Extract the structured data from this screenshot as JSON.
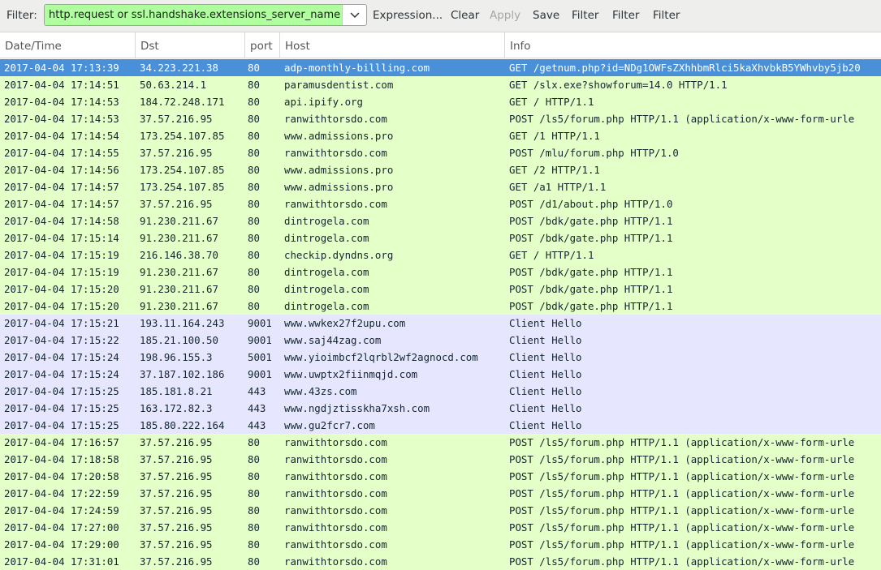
{
  "toolbar": {
    "filter_label": "Filter:",
    "filter_value": "http.request or ssl.handshake.extensions_server_name",
    "expression_label": "Expression...",
    "clear_label": "Clear",
    "apply_label": "Apply",
    "save_label": "Save",
    "filter_buttons": [
      "Filter",
      "Filter",
      "Filter"
    ]
  },
  "columns": [
    "Date/Time",
    "Dst",
    "port",
    "Host",
    "Info"
  ],
  "colors": {
    "http_row": "#e4ffc7",
    "tls_row": "#e7e6ff",
    "selected_row": "#4a90d9",
    "filter_valid": "#afff9f"
  },
  "rows": [
    {
      "time": "2017-04-04 17:13:39",
      "dst": "34.223.221.38",
      "port": "80",
      "host": "adp-monthly-billling.com",
      "info": "GET /getnum.php?id=NDg1OWFsZXhhbmRlci5kaXhvbkB5YWhvby5jb20",
      "kind": "selected"
    },
    {
      "time": "2017-04-04 17:14:51",
      "dst": "50.63.214.1",
      "port": "80",
      "host": "paramusdentist.com",
      "info": "GET /slx.exe?showforum=14.0 HTTP/1.1",
      "kind": "http"
    },
    {
      "time": "2017-04-04 17:14:53",
      "dst": "184.72.248.171",
      "port": "80",
      "host": "api.ipify.org",
      "info": "GET / HTTP/1.1",
      "kind": "http"
    },
    {
      "time": "2017-04-04 17:14:53",
      "dst": "37.57.216.95",
      "port": "80",
      "host": "ranwithtorsdo.com",
      "info": "POST /ls5/forum.php HTTP/1.1  (application/x-www-form-urle",
      "kind": "http"
    },
    {
      "time": "2017-04-04 17:14:54",
      "dst": "173.254.107.85",
      "port": "80",
      "host": "www.admissions.pro",
      "info": "GET /1 HTTP/1.1",
      "kind": "http"
    },
    {
      "time": "2017-04-04 17:14:55",
      "dst": "37.57.216.95",
      "port": "80",
      "host": "ranwithtorsdo.com",
      "info": "POST /mlu/forum.php HTTP/1.0",
      "kind": "http"
    },
    {
      "time": "2017-04-04 17:14:56",
      "dst": "173.254.107.85",
      "port": "80",
      "host": "www.admissions.pro",
      "info": "GET /2 HTTP/1.1",
      "kind": "http"
    },
    {
      "time": "2017-04-04 17:14:57",
      "dst": "173.254.107.85",
      "port": "80",
      "host": "www.admissions.pro",
      "info": "GET /a1 HTTP/1.1",
      "kind": "http"
    },
    {
      "time": "2017-04-04 17:14:57",
      "dst": "37.57.216.95",
      "port": "80",
      "host": "ranwithtorsdo.com",
      "info": "POST /d1/about.php HTTP/1.0",
      "kind": "http"
    },
    {
      "time": "2017-04-04 17:14:58",
      "dst": "91.230.211.67",
      "port": "80",
      "host": "dintrogela.com",
      "info": "POST /bdk/gate.php HTTP/1.1",
      "kind": "http"
    },
    {
      "time": "2017-04-04 17:15:14",
      "dst": "91.230.211.67",
      "port": "80",
      "host": "dintrogela.com",
      "info": "POST /bdk/gate.php HTTP/1.1",
      "kind": "http"
    },
    {
      "time": "2017-04-04 17:15:19",
      "dst": "216.146.38.70",
      "port": "80",
      "host": "checkip.dyndns.org",
      "info": "GET / HTTP/1.1",
      "kind": "http"
    },
    {
      "time": "2017-04-04 17:15:19",
      "dst": "91.230.211.67",
      "port": "80",
      "host": "dintrogela.com",
      "info": "POST /bdk/gate.php HTTP/1.1",
      "kind": "http"
    },
    {
      "time": "2017-04-04 17:15:20",
      "dst": "91.230.211.67",
      "port": "80",
      "host": "dintrogela.com",
      "info": "POST /bdk/gate.php HTTP/1.1",
      "kind": "http"
    },
    {
      "time": "2017-04-04 17:15:20",
      "dst": "91.230.211.67",
      "port": "80",
      "host": "dintrogela.com",
      "info": "POST /bdk/gate.php HTTP/1.1",
      "kind": "http"
    },
    {
      "time": "2017-04-04 17:15:21",
      "dst": "193.11.164.243",
      "port": "9001",
      "host": "www.wwkex27f2upu.com",
      "info": "Client Hello",
      "kind": "tls"
    },
    {
      "time": "2017-04-04 17:15:22",
      "dst": "185.21.100.50",
      "port": "9001",
      "host": "www.saj44zag.com",
      "info": "Client Hello",
      "kind": "tls"
    },
    {
      "time": "2017-04-04 17:15:24",
      "dst": "198.96.155.3",
      "port": "5001",
      "host": "www.yioimbcf2lqrbl2wf2agnocd.com",
      "info": "Client Hello",
      "kind": "tls"
    },
    {
      "time": "2017-04-04 17:15:24",
      "dst": "37.187.102.186",
      "port": "9001",
      "host": "www.uwptx2fiinmqjd.com",
      "info": "Client Hello",
      "kind": "tls"
    },
    {
      "time": "2017-04-04 17:15:25",
      "dst": "185.181.8.21",
      "port": "443",
      "host": "www.43zs.com",
      "info": "Client Hello",
      "kind": "tls"
    },
    {
      "time": "2017-04-04 17:15:25",
      "dst": "163.172.82.3",
      "port": "443",
      "host": "www.ngdjztisskha7xsh.com",
      "info": "Client Hello",
      "kind": "tls"
    },
    {
      "time": "2017-04-04 17:15:25",
      "dst": "185.80.222.164",
      "port": "443",
      "host": "www.gu2fcr7.com",
      "info": "Client Hello",
      "kind": "tls"
    },
    {
      "time": "2017-04-04 17:16:57",
      "dst": "37.57.216.95",
      "port": "80",
      "host": "ranwithtorsdo.com",
      "info": "POST /ls5/forum.php HTTP/1.1  (application/x-www-form-urle",
      "kind": "http"
    },
    {
      "time": "2017-04-04 17:18:58",
      "dst": "37.57.216.95",
      "port": "80",
      "host": "ranwithtorsdo.com",
      "info": "POST /ls5/forum.php HTTP/1.1  (application/x-www-form-urle",
      "kind": "http"
    },
    {
      "time": "2017-04-04 17:20:58",
      "dst": "37.57.216.95",
      "port": "80",
      "host": "ranwithtorsdo.com",
      "info": "POST /ls5/forum.php HTTP/1.1  (application/x-www-form-urle",
      "kind": "http"
    },
    {
      "time": "2017-04-04 17:22:59",
      "dst": "37.57.216.95",
      "port": "80",
      "host": "ranwithtorsdo.com",
      "info": "POST /ls5/forum.php HTTP/1.1  (application/x-www-form-urle",
      "kind": "http"
    },
    {
      "time": "2017-04-04 17:24:59",
      "dst": "37.57.216.95",
      "port": "80",
      "host": "ranwithtorsdo.com",
      "info": "POST /ls5/forum.php HTTP/1.1  (application/x-www-form-urle",
      "kind": "http"
    },
    {
      "time": "2017-04-04 17:27:00",
      "dst": "37.57.216.95",
      "port": "80",
      "host": "ranwithtorsdo.com",
      "info": "POST /ls5/forum.php HTTP/1.1  (application/x-www-form-urle",
      "kind": "http"
    },
    {
      "time": "2017-04-04 17:29:00",
      "dst": "37.57.216.95",
      "port": "80",
      "host": "ranwithtorsdo.com",
      "info": "POST /ls5/forum.php HTTP/1.1  (application/x-www-form-urle",
      "kind": "http"
    },
    {
      "time": "2017-04-04 17:31:01",
      "dst": "37.57.216.95",
      "port": "80",
      "host": "ranwithtorsdo.com",
      "info": "POST /ls5/forum.php HTTP/1.1  (application/x-www-form-urle",
      "kind": "http"
    }
  ]
}
